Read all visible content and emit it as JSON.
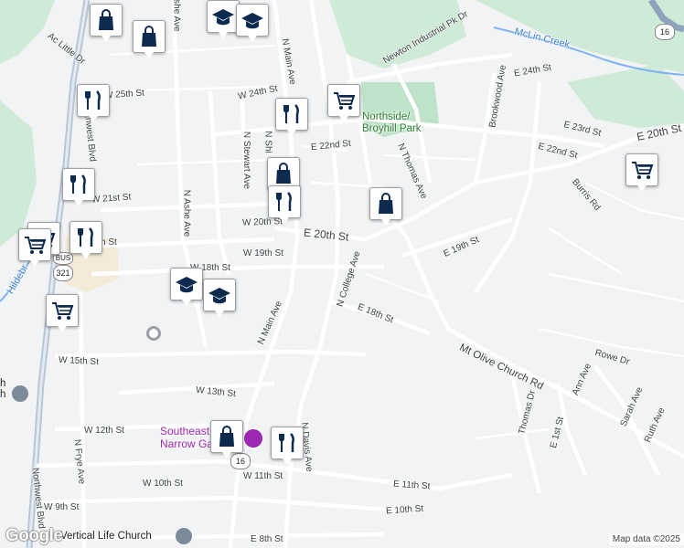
{
  "map": {
    "attribution": "Map data ©2025",
    "logo_text": "Google",
    "park_name": "Northside/\nBroyhill Park",
    "creek_name": "McLin Creek",
    "poi_name": "Southeast\nNarrow Gauge",
    "church_name": "Vertical Life Church",
    "partial_church": "h\nh",
    "partial_creek": "Hildebr",
    "route_shields": [
      "16",
      "16",
      "321",
      "BUS"
    ],
    "streets": [
      "Newton Industrial Pk Dr",
      "Ac Little Dr",
      "W 25th St",
      "W 24th St",
      "E 24th St",
      "Brookwood Ave",
      "E 23rd St",
      "E 22nd St",
      "E 22nd St",
      "E 20th St",
      "E 20th St",
      "W 21st St",
      "W 20th St",
      "W 19th St",
      "W 18th St",
      "E 19th St",
      "E 18th St",
      "Burris Rd",
      "N Main Ave",
      "N Main Ave",
      "N Ashe Ave",
      "Ashe Ave",
      "N Stewart Ave",
      "N Shi",
      "N College Ave",
      "N Thomas Ave",
      "Northwest Blvd",
      "Northwest Blvd",
      "Mt Olive Church Rd",
      "Rowe Dr",
      "Ann Ave",
      "Sarah Ave",
      "Ruth Ave",
      "Thomas Dr",
      "E 1st St",
      "W 15th St",
      "W 13th St",
      "W 12th St",
      "N Frye Ave",
      "N Davis Ave",
      "W 11th St",
      "E 11th St",
      "W 10th St",
      "E 10th St",
      "W 9th St",
      "E 8th St",
      "h St"
    ],
    "markers": [
      {
        "type": "shopping-bag"
      },
      {
        "type": "shopping-bag"
      },
      {
        "type": "school"
      },
      {
        "type": "school"
      },
      {
        "type": "restaurant"
      },
      {
        "type": "restaurant"
      },
      {
        "type": "cart"
      },
      {
        "type": "shopping-bag"
      },
      {
        "type": "restaurant"
      },
      {
        "type": "restaurant"
      },
      {
        "type": "shopping-bag"
      },
      {
        "type": "cart"
      },
      {
        "type": "cart"
      },
      {
        "type": "restaurant"
      },
      {
        "type": "cart"
      },
      {
        "type": "school"
      },
      {
        "type": "school"
      },
      {
        "type": "cart"
      },
      {
        "type": "shopping-bag"
      },
      {
        "type": "restaurant"
      }
    ]
  }
}
